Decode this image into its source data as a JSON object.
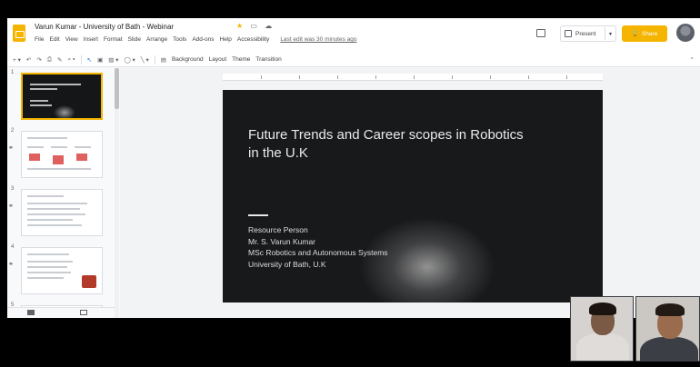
{
  "window": {
    "doc_title": "Varun Kumar - University of Bath - Webinar",
    "menu": [
      "File",
      "Edit",
      "View",
      "Insert",
      "Format",
      "Slide",
      "Arrange",
      "Tools",
      "Add-ons",
      "Help",
      "Accessibility"
    ],
    "last_edit": "Last edit was 30 minutes ago",
    "present_label": "Present",
    "share_label": "Share"
  },
  "toolbar": {
    "background": "Background",
    "layout": "Layout",
    "theme": "Theme",
    "transition": "Transition"
  },
  "filmstrip": {
    "slides": [
      {
        "num": "1"
      },
      {
        "num": "2"
      },
      {
        "num": "3"
      },
      {
        "num": "4"
      },
      {
        "num": "5"
      }
    ]
  },
  "slide": {
    "title_line1": "Future Trends and Career scopes in Robotics",
    "title_line2": "in the U.K",
    "body": [
      "Resource Person",
      "Mr. S. Varun Kumar",
      "MSc Robotics and Autonomous Systems",
      "University of Bath, U.K"
    ]
  },
  "colors": {
    "accent": "#f4b400",
    "slide_bg": "#18191b",
    "app_bg": "#f8f9fa"
  }
}
